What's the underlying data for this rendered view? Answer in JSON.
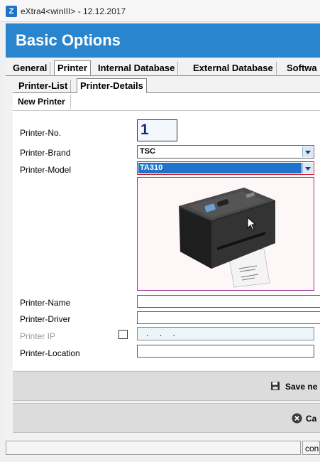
{
  "window": {
    "icon_letter": "Z",
    "title": "eXtra4<winIII>  -  12.12.2017"
  },
  "header": {
    "title": "Basic Options"
  },
  "main_tabs": [
    {
      "label": "General"
    },
    {
      "label": "Printer"
    },
    {
      "label": "Internal Database"
    },
    {
      "label": "External Database"
    },
    {
      "label": "Softwa"
    }
  ],
  "sub_tabs": [
    {
      "label": "Printer-List"
    },
    {
      "label": "Printer-Details"
    }
  ],
  "detail_tab": {
    "label": "New Printer"
  },
  "form": {
    "printer_no_label": "Printer-No.",
    "printer_no_value": "1",
    "brand_label": "Printer-Brand",
    "brand_value": "TSC",
    "model_label": "Printer-Model",
    "model_value": "TA310",
    "name_label": "Printer-Name",
    "driver_label": "Printer-Driver",
    "ip_label": "Printer IP",
    "ip_value": ". . .",
    "location_label": "Printer-Location"
  },
  "buttons": {
    "save_label": "Save ne",
    "cancel_label": "Ca"
  },
  "status": {
    "text": "con"
  },
  "colors": {
    "header_bg": "#2a85cf",
    "selected_combo_bg": "#1f73c8",
    "selected_combo_border": "#d0202a",
    "image_border": "#9b2a94"
  }
}
